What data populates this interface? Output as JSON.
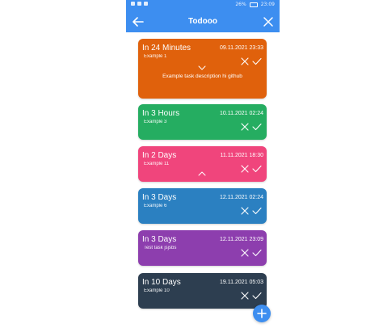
{
  "statusbar": {
    "battery_pct": "26%",
    "time": "23:09"
  },
  "appbar": {
    "title": "Todooo",
    "back_icon": "arrow-left-icon",
    "close_icon": "close-icon"
  },
  "tasks": [
    {
      "due_label": "In 24 Minutes",
      "datetime": "09.11.2021 23:33",
      "title": "Example 1",
      "description": "Example task description hi github",
      "color": "#e0610c",
      "expanded": true
    },
    {
      "due_label": "In 3 Hours",
      "datetime": "10.11.2021 02:24",
      "title": "Example 3",
      "color": "#25ad61"
    },
    {
      "due_label": "In 2 Days",
      "datetime": "11.11.2021 18:30",
      "title": "Example 11",
      "color": "#f0457c"
    },
    {
      "due_label": "In 3 Days",
      "datetime": "12.11.2021 02:24",
      "title": "Example 6",
      "color": "#2b80c1"
    },
    {
      "due_label": "In 3 Days",
      "datetime": "12.11.2021 23:09",
      "title": "Test task jsjsbs",
      "color": "#8d3eae"
    },
    {
      "due_label": "In 10 Days",
      "datetime": "19.11.2021 05:03",
      "title": "Example 10",
      "color": "#2d3e50"
    }
  ],
  "fab": {
    "icon": "plus-icon",
    "color": "#3d8ef0"
  }
}
